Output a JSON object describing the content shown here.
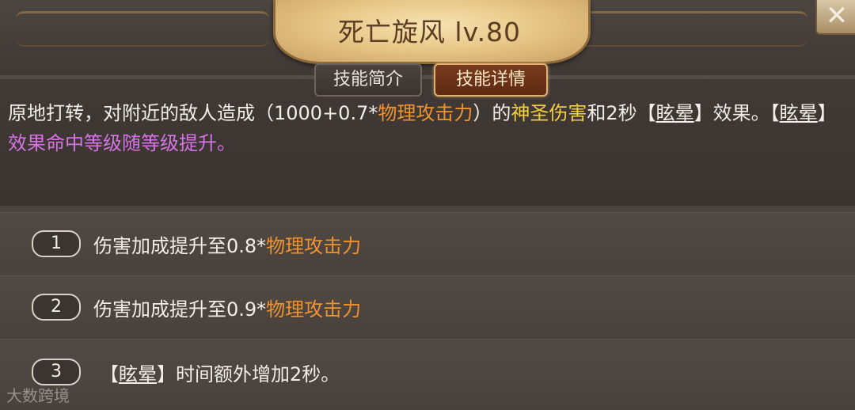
{
  "title": "死亡旋风 lv.80",
  "close_label": "✕",
  "tabs": {
    "intro": "技能简介",
    "detail": "技能详情"
  },
  "description": {
    "p1": "原地打转，对附近的敌人造成（1000+0.7*",
    "p2": "物理攻击力",
    "p3": "）的",
    "p4": "神圣伤害",
    "p5": "和2秒【",
    "p6": "眩晕",
    "p7": "】效果。【",
    "p8": "眩晕",
    "p9": "】",
    "p10": "效果命中等级随等级提升。"
  },
  "upgrades": [
    {
      "num": "1",
      "text": "伤害加成提升至0.8*",
      "highlight": "物理攻击力"
    },
    {
      "num": "2",
      "text": "伤害加成提升至0.9*",
      "highlight": "物理攻击力"
    },
    {
      "num": "3",
      "pre": "【",
      "link": "眩晕",
      "text": "】时间额外增加2秒。"
    }
  ],
  "watermark": "大数跨境",
  "colors": {
    "title_plate": "#e8c98a",
    "active_tab": "#5e2b14",
    "orange_text": "#f1932e",
    "yellow_text": "#f4d13c",
    "purple_text": "#d673e6"
  }
}
